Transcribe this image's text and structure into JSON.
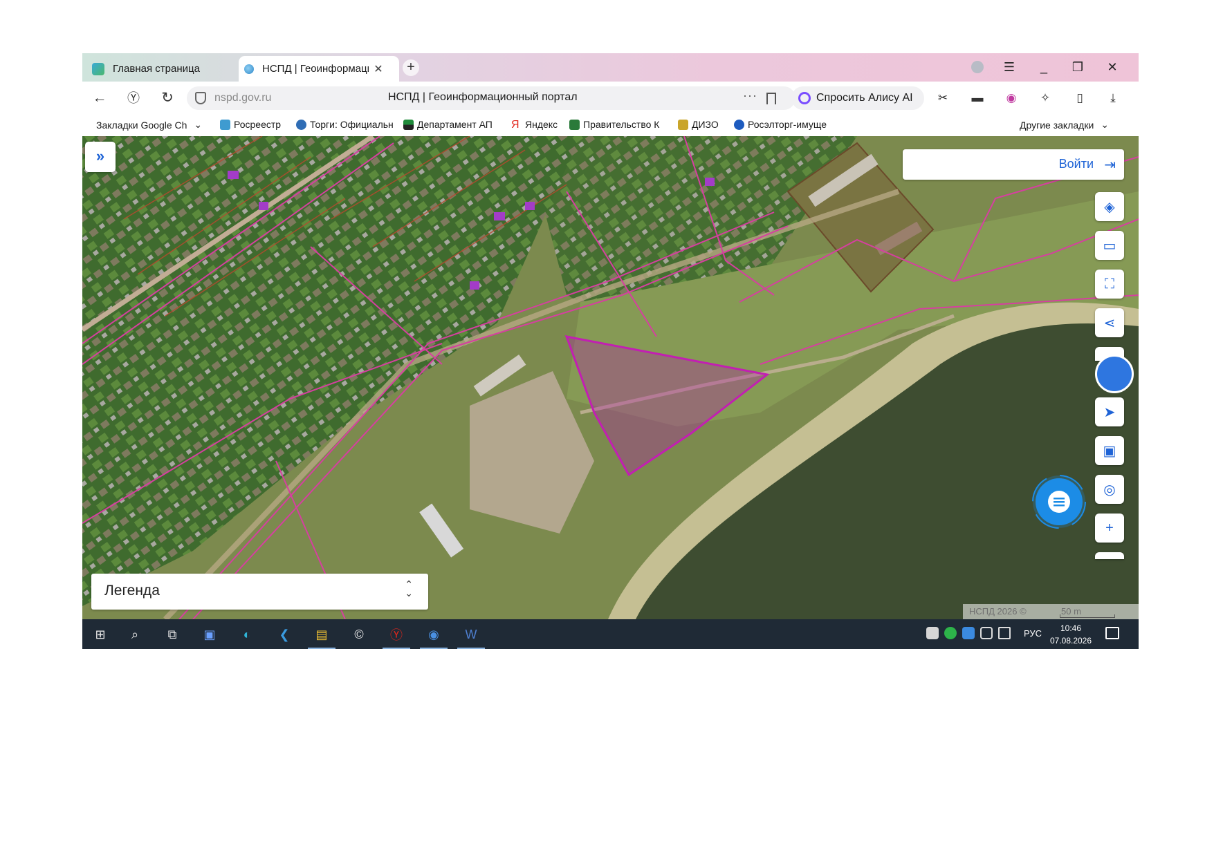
{
  "tabs": [
    {
      "title": "Главная страница",
      "active": false
    },
    {
      "title": "НСПД | Геоинформаци",
      "active": true
    }
  ],
  "tab_close": "✕",
  "new_tab": "+",
  "window": {
    "minimize": "_",
    "restore": "❐",
    "close": "✕",
    "menu": "☰"
  },
  "address": {
    "url": "nspd.gov.ru",
    "page_title": "НСПД | Геоинформационный портал",
    "more": "···"
  },
  "alisa_label": "Спросить Алису AI",
  "bookmarks": [
    {
      "label": "Закладки Google Ch",
      "icon_color": "#ffffff",
      "dropdown": "⌄"
    },
    {
      "label": "Росреестр",
      "icon_color": "#3f9bd0"
    },
    {
      "label": "Торги: Официальн",
      "icon_color": "#2f6db5"
    },
    {
      "label": "Департамент АП",
      "icon_color": "#1f8a3a"
    },
    {
      "label": "Яндекс",
      "icon_color": "#e1261c"
    },
    {
      "label": "Правительство К",
      "icon_color": "#2a7a3a"
    },
    {
      "label": "ДИЗО",
      "icon_color": "#c9a52a"
    },
    {
      "label": "Росэлторг-имуще",
      "icon_color": "#1d5bbf"
    }
  ],
  "other_bookmarks": "Другие закладки",
  "other_bookmarks_chevron": "⌄",
  "map": {
    "login_label": "Войти",
    "login_icon": "⇥",
    "expand_icon": "»",
    "legend_label": "Легенда",
    "legend_chevron": "⌃\n⌄",
    "copyright": "НСПД 2026 ©",
    "scale": "50 m",
    "tools": [
      {
        "name": "layers-icon",
        "glyph": "◈"
      },
      {
        "name": "ruler-icon",
        "glyph": "▭"
      },
      {
        "name": "select-area-icon",
        "glyph": "⛶"
      },
      {
        "name": "share-icon",
        "glyph": "⋖"
      },
      {
        "name": "navigate-icon",
        "glyph": "➤"
      },
      {
        "name": "minimap-icon",
        "glyph": "▣"
      },
      {
        "name": "search-location-icon",
        "glyph": "◎"
      },
      {
        "name": "zoom-in-icon",
        "glyph": "+"
      }
    ],
    "colors": {
      "parcel": "#d63fa0",
      "selected_parcel": "#c21fb2",
      "accent": "#1e63d6"
    }
  },
  "taskbar": {
    "lang": "РУС",
    "time": "10:46",
    "date": "07.08.2026"
  }
}
